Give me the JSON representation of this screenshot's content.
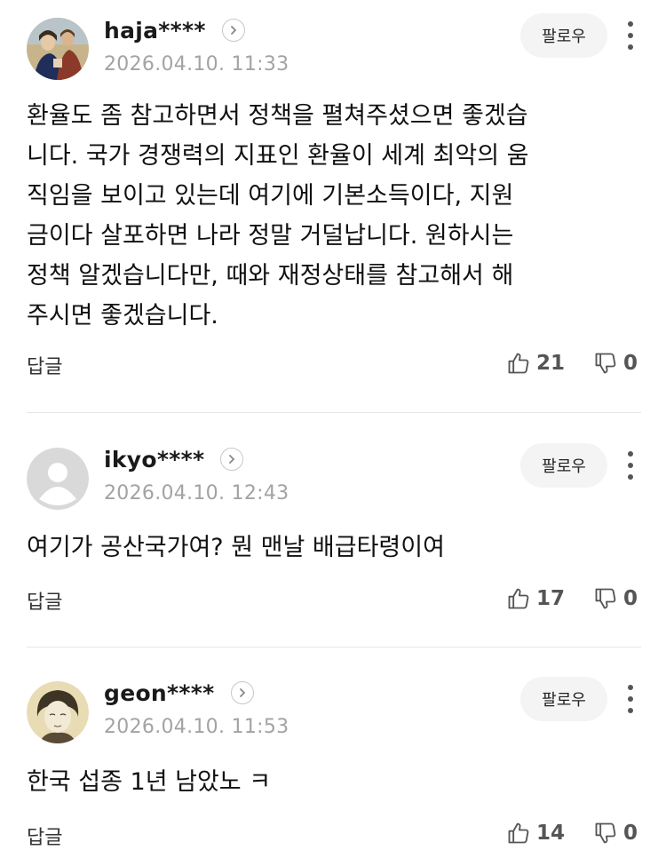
{
  "comments": [
    {
      "username": "haja****",
      "timestamp": "2026.04.10. 11:33",
      "follow_label": "팔로우",
      "text": "환율도 좀 참고하면서 정책을 펼쳐주셨으면 좋겠습\n니다. 국가 경쟁력의 지표인 환율이 세계 최악의 움\n직임을 보이고 있는데 여기에 기본소득이다, 지원\n금이다 살포하면 나라 정말 거덜납니다. 원하시는\n정책 알겠습니다만, 때와 재정상태를 참고해서 해\n주시면 좋겠습니다.",
      "reply_label": "답글",
      "likes": "21",
      "dislikes": "0"
    },
    {
      "username": "ikyo****",
      "timestamp": "2026.04.10. 12:43",
      "follow_label": "팔로우",
      "text": "여기가 공산국가여? 뭔 맨날 배급타령이여",
      "reply_label": "답글",
      "likes": "17",
      "dislikes": "0"
    },
    {
      "username": "geon****",
      "timestamp": "2026.04.10. 11:53",
      "follow_label": "팔로우",
      "text": "한국 섭종 1년 남았노 ㅋ",
      "reply_label": "답글",
      "likes": "14",
      "dislikes": "0"
    }
  ],
  "icons": {
    "chevron": "chevron-right-icon",
    "thumbs_up": "thumbs-up-icon",
    "thumbs_down": "thumbs-down-icon",
    "more": "more-vertical-icon"
  },
  "colors": {
    "text": "#111111",
    "muted": "#a3a3a3",
    "follow_bg": "#f4f4f4",
    "divider": "#e6e6e6"
  }
}
